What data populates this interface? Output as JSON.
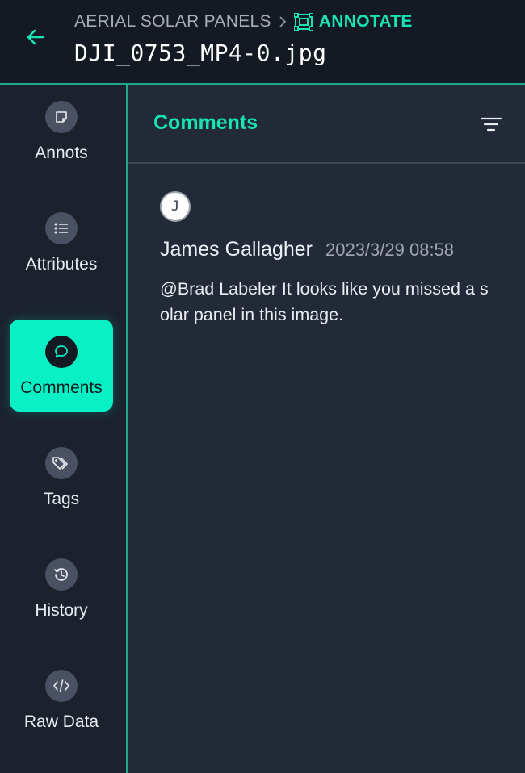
{
  "header": {
    "project_name": "AERIAL SOLAR PANELS",
    "current_page": "ANNOTATE",
    "file_name": "DJI_0753_MP4-0.jpg"
  },
  "sidebar": {
    "items": [
      {
        "label": "Annots",
        "icon": "note-icon"
      },
      {
        "label": "Attributes",
        "icon": "list-icon"
      },
      {
        "label": "Comments",
        "icon": "comment-icon",
        "active": true
      },
      {
        "label": "Tags",
        "icon": "tags-icon"
      },
      {
        "label": "History",
        "icon": "history-icon"
      },
      {
        "label": "Raw Data",
        "icon": "code-icon"
      }
    ]
  },
  "panel": {
    "title": "Comments",
    "filter_icon": "filter-icon"
  },
  "comments": [
    {
      "avatar_initial": "J",
      "author": "James Gallagher",
      "timestamp": "2023/3/29 08:58",
      "body": "@Brad Labeler It looks like you missed a solar panel in this image."
    }
  ],
  "colors": {
    "accent": "#17e3b4",
    "active_bg": "#08f0c4",
    "header_bg": "#141a24",
    "sidebar_bg": "#1b222e",
    "panel_bg": "#222a38",
    "border": "#1fa88e"
  }
}
